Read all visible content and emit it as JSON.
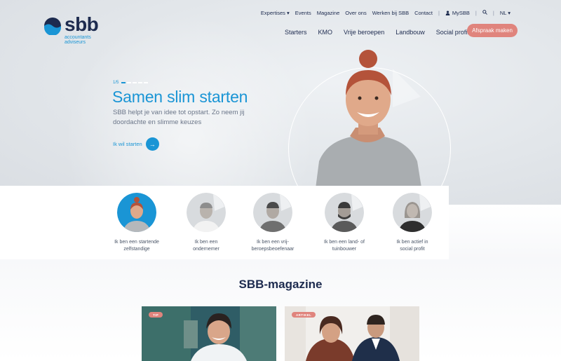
{
  "logo": {
    "word": "sbb",
    "line1": "accountants",
    "line2": "adviseurs"
  },
  "top_nav": {
    "expertises": "Expertises ▾",
    "events": "Events",
    "magazine": "Magazine",
    "over_ons": "Over ons",
    "werken": "Werken bij SBB",
    "contact": "Contact",
    "mysbb": "MySBB",
    "language": "NL ▾"
  },
  "main_nav": {
    "items": [
      "Starters",
      "KMO",
      "Vrije beroepen",
      "Landbouw",
      "Social profit"
    ],
    "cta": "Afspraak maken"
  },
  "hero": {
    "counter": "1/5",
    "title": "Samen slim starten",
    "description": "SBB helpt je van idee tot opstart. Zo neem jij doordachte en slimme keuzes",
    "link_label": "Ik wil starten"
  },
  "personas": [
    {
      "line1": "Ik ben een startende",
      "line2": "zelfstandige"
    },
    {
      "line1": "Ik ben een",
      "line2": "ondernemer"
    },
    {
      "line1": "Ik ben een vrij-",
      "line2": "beroepsbeoefenaar"
    },
    {
      "line1": "Ik ben een land- of",
      "line2": "tuinbouwer"
    },
    {
      "line1": "Ik ben actief in",
      "line2": "social profit"
    }
  ],
  "magazine": {
    "title": "SBB-magazine",
    "cards": [
      {
        "badge": "TIP"
      },
      {
        "badge": "ARTIKEL"
      }
    ]
  },
  "colors": {
    "accent": "#1a95d5",
    "navy": "#1d2b4f",
    "coral": "#e0847d"
  }
}
